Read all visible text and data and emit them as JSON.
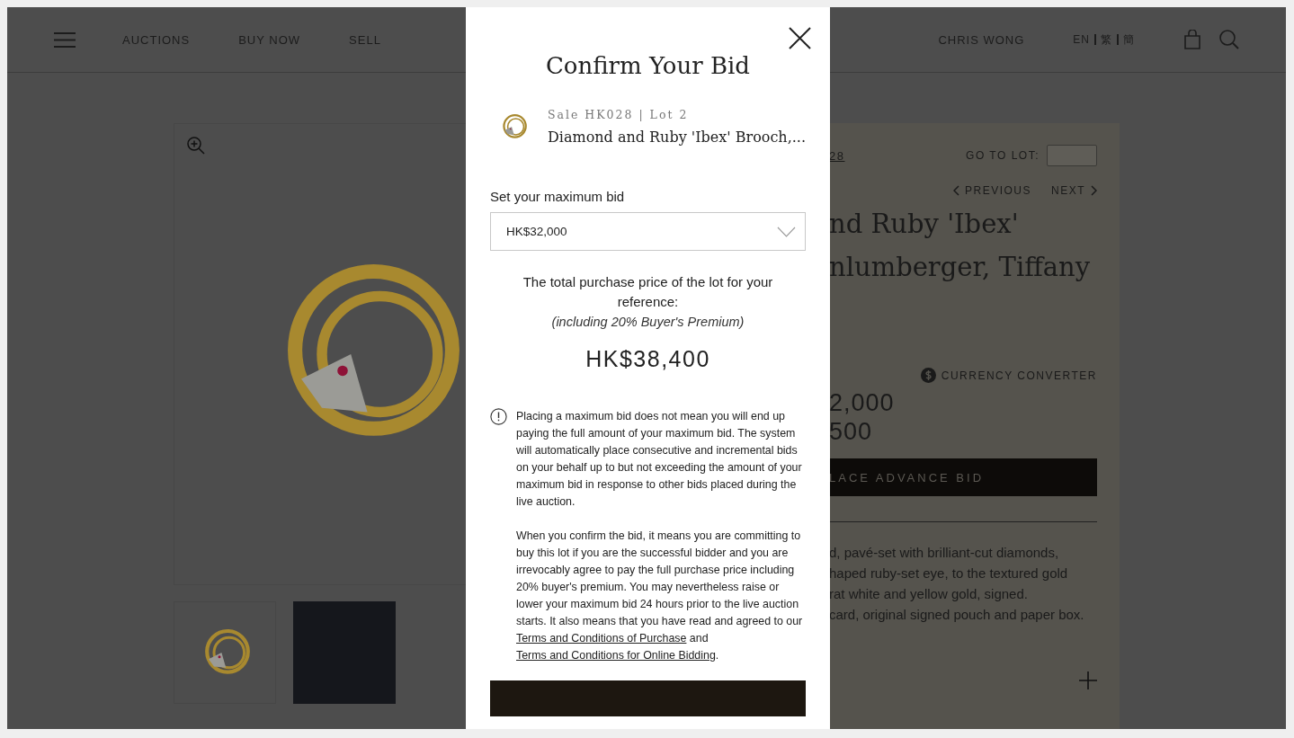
{
  "header": {
    "nav": [
      "AUCTIONS",
      "BUY NOW",
      "SELL"
    ],
    "user": "CHRIS WONG",
    "languages": [
      "EN",
      "繁",
      "簡"
    ]
  },
  "lot_panel": {
    "sale_link": "28",
    "go_to_lot_label": "GO TO LOT:",
    "previous": "PREVIOUS",
    "next": "NEXT",
    "title_lines": [
      "nd Ruby 'Ibex'",
      "nlumberger, Tiffany"
    ],
    "currency_converter": "CURRENCY CONVERTER",
    "estimate_lines": [
      "2,000",
      "500"
    ],
    "advance_bid_button": "LACE ADVANCE BID",
    "description_lines": [
      "d, pavé-set with brilliant-cut diamonds,",
      "haped ruby-set eye, to the textured gold",
      "rat white and yellow gold, signed.",
      "card, original signed pouch and paper box."
    ]
  },
  "modal": {
    "title": "Confirm Your Bid",
    "sale_lot": "Sale HK028 | Lot 2",
    "lot_title": "Diamond and Ruby 'Ibex' Brooch,...",
    "bid_label": "Set your maximum bid",
    "bid_value": "HK$32,000",
    "total_text": "The total purchase price of the lot for your reference:",
    "premium_note": "(including 20% Buyer's Premium)",
    "total_price": "HK$38,400",
    "notice": "Placing a maximum bid does not mean you will end up paying the full amount of your maximum bid. The system will automatically place consecutive and incremental bids on your behalf up to but not exceeding the amount of your maximum bid in response to other bids placed during the live auction.",
    "terms_parts": [
      {
        "kind": "text",
        "text": "When you confirm the bid, it means you are committing to buy this lot if you are the successful bidder and you are irrevocably agree to pay the full purchase price including 20% buyer's premium. You may nevertheless raise or lower your maximum bid 24 hours prior to the live auction starts. It also means that you have read and agreed to our "
      },
      {
        "kind": "link",
        "text": "Terms and Conditions of Purchase"
      },
      {
        "kind": "text",
        "text": " and "
      },
      {
        "kind": "link",
        "text": "Terms and Conditions for Online Bidding"
      },
      {
        "kind": "text",
        "text": "."
      }
    ]
  }
}
